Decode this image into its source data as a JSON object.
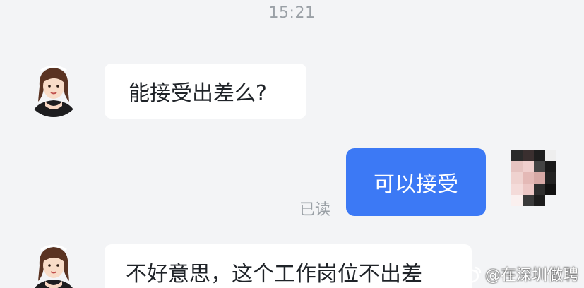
{
  "chat": {
    "timestamp": "15:21",
    "messages": [
      {
        "sender": "recruiter",
        "text": "能接受出差么?"
      },
      {
        "sender": "me",
        "text": "可以接受",
        "status": "已读"
      },
      {
        "sender": "recruiter",
        "text": "不好意思，这个工作岗位不出差"
      }
    ]
  },
  "watermark": {
    "icon": "weibo-logo",
    "text": "@在深圳做聘"
  },
  "colors": {
    "background": "#f3f4f6",
    "bubble_incoming": "#ffffff",
    "bubble_outgoing": "#3c79f5",
    "muted_text": "#9aa0a6"
  }
}
